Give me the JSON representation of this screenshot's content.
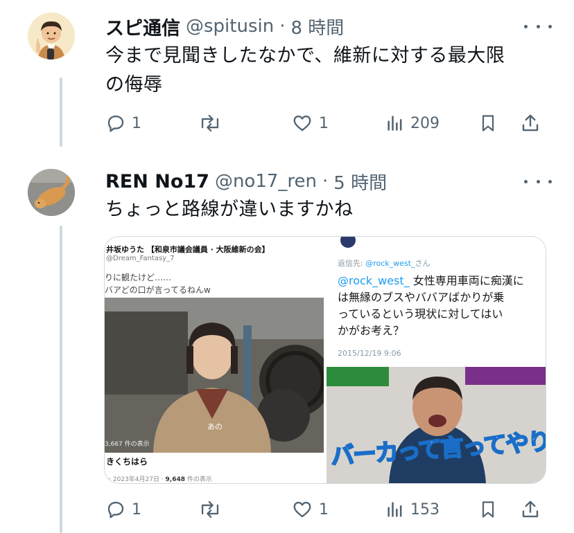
{
  "tweet1": {
    "name": "スピ通信",
    "handle": "@spitusin",
    "time": "8 時間",
    "text_line1": "今まで見聞きしたなかで、維新に対する最大限",
    "text_line2": "の侮辱",
    "replies": "1",
    "likes": "1",
    "views": "209"
  },
  "tweet2": {
    "name": "REN No17",
    "handle": "@no17_ren",
    "time": "5 時間",
    "text": "ちょっと路線が違いますかね",
    "replies": "1",
    "likes": "1",
    "views": "153"
  },
  "left_image": {
    "header": "井坂ゆうた 【和泉市議会議員 · 大阪維新の会】",
    "sub": "@Dream_Fantasy_7",
    "quote_line1": "りに観たけど……",
    "quote_line2": "バアどの口が言ってるねんw",
    "subtitle": "あの",
    "views_overlay": "3,667 件の表示",
    "caption": "きくちはら",
    "footer_date": "ー 2023年4月27日 · ",
    "footer_views": "9,648",
    "footer_views_suffix": " 件の表示"
  },
  "right_image": {
    "reply_to_prefix": "返信先: ",
    "reply_to": "@rock_west_",
    "reply_to_suffix": "さん",
    "mention": "@rock_west_",
    "line1": " 女性専用車両に痴漢に",
    "line2": "は無縁のブスやババアばかりが乗",
    "line3": "っているという現状に対してはい",
    "line4": "かがお考え？",
    "date": "2015/12/19 9:06",
    "caption": "バーカって言ってやりたい"
  }
}
